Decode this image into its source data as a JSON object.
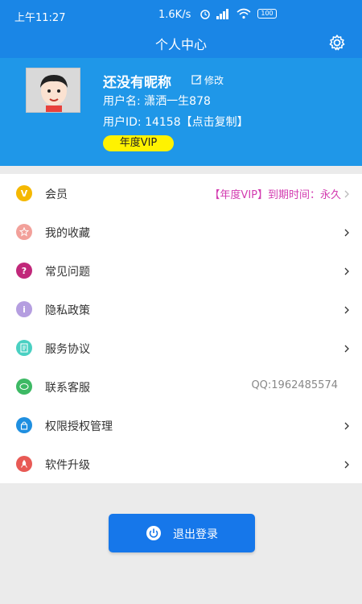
{
  "status_bar": {
    "time": "上午11:27",
    "network_speed": "1.6K/s",
    "battery": "100",
    "icons": [
      "alarm-icon",
      "signal-icon",
      "wifi-icon",
      "battery-icon"
    ]
  },
  "header": {
    "title": "个人中心",
    "settings_icon": "gear-icon"
  },
  "profile": {
    "nickname": "还没有昵称",
    "edit_label": "修改",
    "username": "用户名: 潇洒一生878",
    "user_id": "用户ID: 14158【点击复制】",
    "vip_badge": "年度VIP"
  },
  "menu": {
    "items": [
      {
        "label": "会员",
        "extra": "【年度VIP】到期时间：永久",
        "icon": "vip-icon",
        "color": "#f5b800"
      },
      {
        "label": "我的收藏",
        "extra": "",
        "icon": "star-icon",
        "color": "#f2a09a"
      },
      {
        "label": "常见问题",
        "extra": "",
        "icon": "question-icon",
        "color": "#c1287a"
      },
      {
        "label": "隐私政策",
        "extra": "",
        "icon": "info-icon",
        "color": "#b59ee0"
      },
      {
        "label": "服务协议",
        "extra": "",
        "icon": "document-icon",
        "color": "#4ad0c2"
      },
      {
        "label": "联系客服",
        "extra": "QQ:1962485574",
        "icon": "chat-icon",
        "color": "#3db964"
      },
      {
        "label": "权限授权管理",
        "extra": "",
        "icon": "lock-icon",
        "color": "#1f8fe0"
      },
      {
        "label": "软件升级",
        "extra": "",
        "icon": "rocket-icon",
        "color": "#e85a55"
      }
    ]
  },
  "logout": {
    "label": "退出登录",
    "icon": "power-icon"
  },
  "colors": {
    "primary": "#1a86e6",
    "vip_text": "#d33bb0",
    "vip_badge": "#fff200"
  }
}
